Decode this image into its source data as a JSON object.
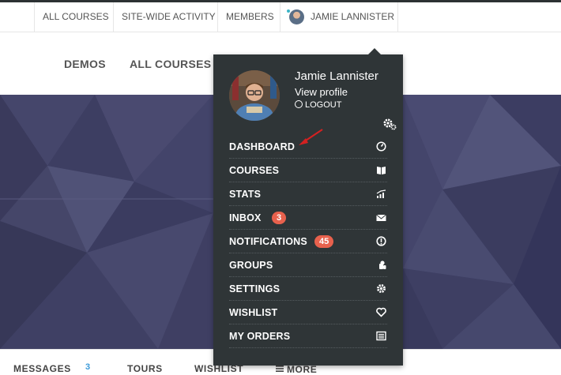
{
  "topbar": {
    "items": [
      "ALL COURSES",
      "SITE-WIDE ACTIVITY",
      "MEMBERS"
    ],
    "user_name": "JAMIE LANNISTER"
  },
  "mainnav": {
    "items": [
      "DEMOS",
      "ALL COURSES"
    ]
  },
  "dropdown": {
    "name": "Jamie Lannister",
    "view_profile": "View profile",
    "logout": "LOGOUT",
    "menu": [
      {
        "label": "DASHBOARD",
        "icon": "dashboard-icon"
      },
      {
        "label": "COURSES",
        "icon": "book-icon"
      },
      {
        "label": "STATS",
        "icon": "stats-icon"
      },
      {
        "label": "INBOX",
        "badge": "3",
        "icon": "envelope-icon"
      },
      {
        "label": "NOTIFICATIONS",
        "badge": "45",
        "icon": "exclamation-icon"
      },
      {
        "label": "GROUPS",
        "icon": "groups-icon"
      },
      {
        "label": "SETTINGS",
        "icon": "gear-icon"
      },
      {
        "label": "WISHLIST",
        "icon": "heart-icon"
      },
      {
        "label": "MY ORDERS",
        "icon": "orders-icon"
      }
    ]
  },
  "subnav": {
    "messages": "MESSAGES",
    "messages_count": "3",
    "tours": "TOURS",
    "wishlist": "WISHLIST",
    "more": "MORE"
  },
  "colors": {
    "dropdown_bg": "#2f3537",
    "badge": "#e8614d",
    "hero": "#3f3f63",
    "accent_count": "#3b9ad9"
  }
}
